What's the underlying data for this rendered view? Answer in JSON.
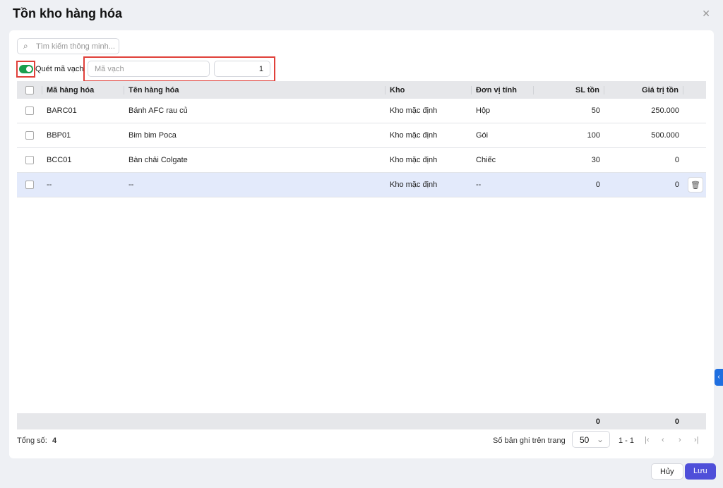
{
  "title": "Tồn kho hàng hóa",
  "search_placeholder": "Tìm kiếm thông minh...",
  "scan_label": "Quét mã vạch",
  "barcode_placeholder": "Mã vạch",
  "quantity_value": "1",
  "columns": [
    "Mã hàng hóa",
    "Tên hàng hóa",
    "Kho",
    "Đơn vị tính",
    "SL tồn",
    "Giá trị tồn"
  ],
  "rows": [
    [
      "BARC01",
      "Bánh AFC rau củ",
      "Kho mặc định",
      "Hộp",
      "50",
      "250.000"
    ],
    [
      "BBP01",
      "Bim bim Poca",
      "Kho mặc định",
      "Gói",
      "100",
      "500.000"
    ],
    [
      "BCC01",
      "Bàn chải Colgate",
      "Kho mặc định",
      "Chiếc",
      "30",
      "0"
    ],
    [
      "--",
      "--",
      "Kho mặc định",
      "--",
      "0",
      "0"
    ]
  ],
  "totals": {
    "qty": "0",
    "value": "0"
  },
  "footer": {
    "total_label": "Tổng số:",
    "total_count": "4",
    "page_size_label": "Số bản ghi trên trang",
    "page_size": "50",
    "range": "1 - 1"
  },
  "buttons": {
    "cancel": "Hủy",
    "save": "Lưu"
  },
  "accent": "#4f4fd9"
}
